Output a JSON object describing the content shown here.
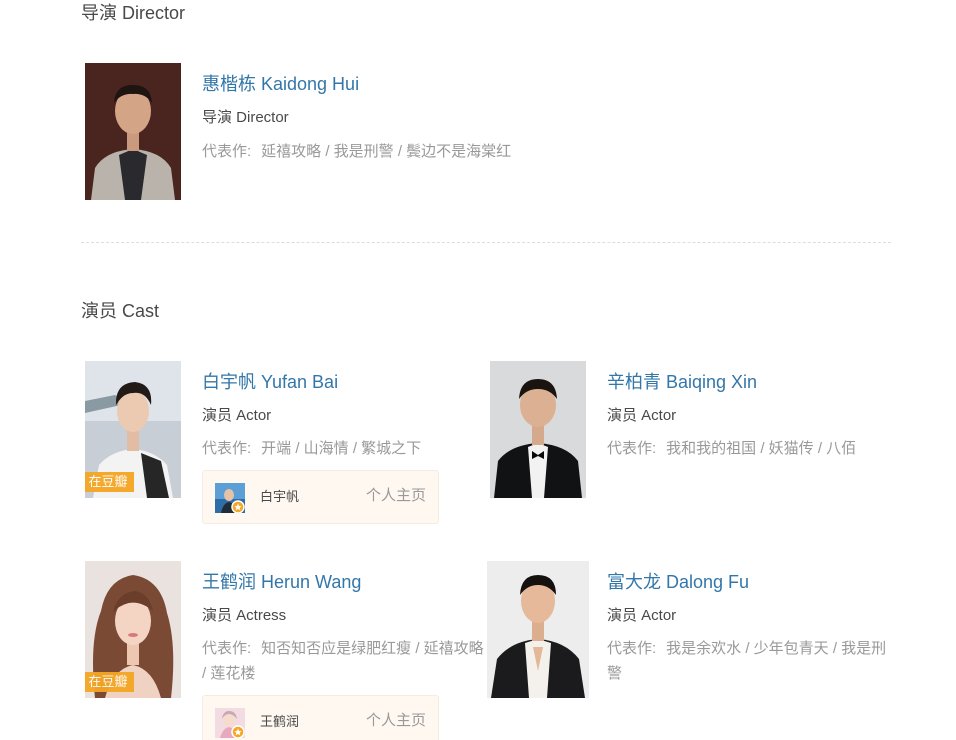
{
  "director_section": {
    "title": "导演 Director",
    "people": [
      {
        "name": "惠楷栋 Kaidong Hui",
        "role": "导演 Director",
        "works_label": "代表作:",
        "works": "延禧攻略 / 我是刑警 / 鬓边不是海棠红"
      }
    ]
  },
  "cast_section": {
    "title": "演员 Cast",
    "people": [
      {
        "name": "白宇帆 Yufan Bai",
        "role": "演员 Actor",
        "works_label": "代表作:",
        "works": "开端 / 山海情 / 繁城之下",
        "tag": "在豆瓣",
        "profile": {
          "name": "白宇帆",
          "link": "个人主页"
        }
      },
      {
        "name": "辛柏青 Baiqing Xin",
        "role": "演员 Actor",
        "works_label": "代表作:",
        "works": "我和我的祖国 / 妖猫传 / 八佰"
      },
      {
        "name": "王鹤润 Herun Wang",
        "role": "演员 Actress",
        "works_label": "代表作:",
        "works": "知否知否应是绿肥红瘦 / 延禧攻略 / 莲花楼",
        "tag": "在豆瓣",
        "profile": {
          "name": "王鹤润",
          "link": "个人主页"
        }
      },
      {
        "name": "富大龙 Dalong Fu",
        "role": "演员 Actor",
        "works_label": "代表作:",
        "works": "我是余欢水 / 少年包青天 / 我是刑警"
      }
    ]
  },
  "colors": {
    "link": "#3377aa",
    "text": "#494949",
    "muted": "#999999",
    "tag": "#f5a623",
    "card_bg": "#fff8f0"
  }
}
